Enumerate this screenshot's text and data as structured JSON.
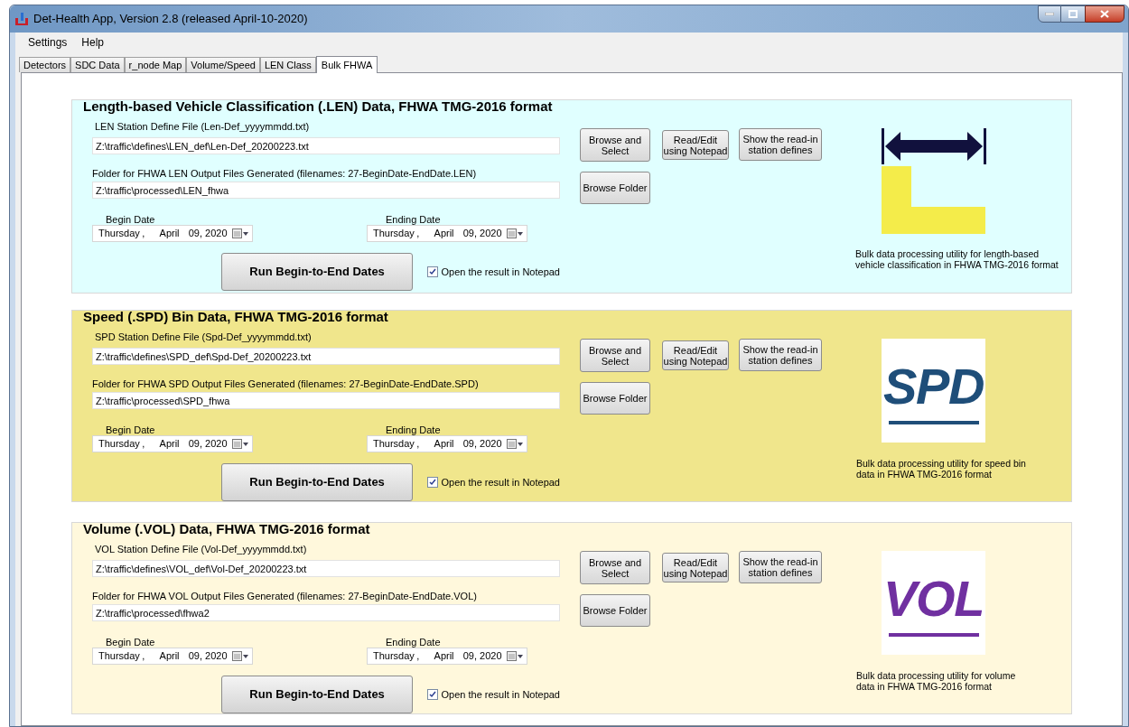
{
  "window": {
    "title": "Det-Health App, Version 2.8 (released April-10-2020)"
  },
  "menu": [
    "Settings",
    "Help"
  ],
  "tabs": [
    {
      "label": "Detectors",
      "selected": false
    },
    {
      "label": "SDC Data",
      "selected": false
    },
    {
      "label": "r_node Map",
      "selected": false
    },
    {
      "label": "Volume/Speed",
      "selected": false
    },
    {
      "label": "LEN Class",
      "selected": false
    },
    {
      "label": "Bulk FHWA",
      "selected": true
    }
  ],
  "panels": [
    {
      "kind": "len",
      "title": "Length-based Vehicle Classification (.LEN) Data, FHWA TMG-2016 format",
      "define_label": "LEN Station Define File (Len-Def_yyyymmdd.txt)",
      "define_value": "Z:\\traffic\\defines\\LEN_def\\Len-Def_20200223.txt",
      "folder_label": "Folder for FHWA LEN Output Files Generated (filenames: 27-BeginDate-EndDate.LEN)",
      "folder_value": "Z:\\traffic\\processed\\LEN_fhwa",
      "begin_label": "Begin Date",
      "begin_date": [
        "Thursday",
        ",",
        "April",
        "09, 2020"
      ],
      "end_label": "Ending Date",
      "end_date": [
        "Thursday",
        ",",
        "April",
        "09, 2020"
      ],
      "run_button": "Run Begin-to-End Dates",
      "open_checkbox": {
        "label": "Open the result in Notepad",
        "checked": true
      },
      "buttons": [
        "Browse and Select",
        "Read/Edit using Notepad",
        "Show the read-in station defines"
      ],
      "folder_button": "Browse Folder",
      "caption": "Bulk data processing utility for length-based vehicle classification in FHWA TMG-2016 format"
    },
    {
      "kind": "spd",
      "title": "Speed (.SPD) Bin Data, FHWA TMG-2016 format",
      "define_label": "SPD Station Define File (Spd-Def_yyyymmdd.txt)",
      "define_value": "Z:\\traffic\\defines\\SPD_def\\Spd-Def_20200223.txt",
      "folder_label": "Folder for FHWA SPD Output Files Generated (filenames: 27-BeginDate-EndDate.SPD)",
      "folder_value": "Z:\\traffic\\processed\\SPD_fhwa",
      "begin_label": "Begin Date",
      "begin_date": [
        "Thursday",
        ",",
        "April",
        "09, 2020"
      ],
      "end_label": "Ending Date",
      "end_date": [
        "Thursday",
        ",",
        "April",
        "09, 2020"
      ],
      "run_button": "Run Begin-to-End Dates",
      "open_checkbox": {
        "label": "Open the result in Notepad",
        "checked": true
      },
      "buttons": [
        "Browse and Select",
        "Read/Edit using Notepad",
        "Show the read-in station defines"
      ],
      "folder_button": "Browse Folder",
      "logo_text": "SPD",
      "caption": "Bulk data processing utility for speed bin data in FHWA TMG-2016 format"
    },
    {
      "kind": "vol",
      "title": "Volume (.VOL) Data, FHWA TMG-2016 format",
      "define_label": "VOL Station Define File (Vol-Def_yyyymmdd.txt)",
      "define_value": "Z:\\traffic\\defines\\VOL_def\\Vol-Def_20200223.txt",
      "folder_label": "Folder for FHWA VOL Output Files Generated (filenames: 27-BeginDate-EndDate.VOL)",
      "folder_value": "Z:\\traffic\\processed\\fhwa2",
      "begin_label": "Begin Date",
      "begin_date": [
        "Thursday",
        ",",
        "April",
        "09, 2020"
      ],
      "end_label": "Ending Date",
      "end_date": [
        "Thursday",
        ",",
        "April",
        "09, 2020"
      ],
      "run_button": "Run Begin-to-End Dates",
      "open_checkbox": {
        "label": "Open the result in Notepad",
        "checked": true
      },
      "buttons": [
        "Browse and Select",
        "Read/Edit using Notepad",
        "Show the read-in station defines"
      ],
      "folder_button": "Browse Folder",
      "logo_text": "VOL",
      "caption": "Bulk data processing utility for volume data in FHWA TMG-2016 format"
    }
  ]
}
